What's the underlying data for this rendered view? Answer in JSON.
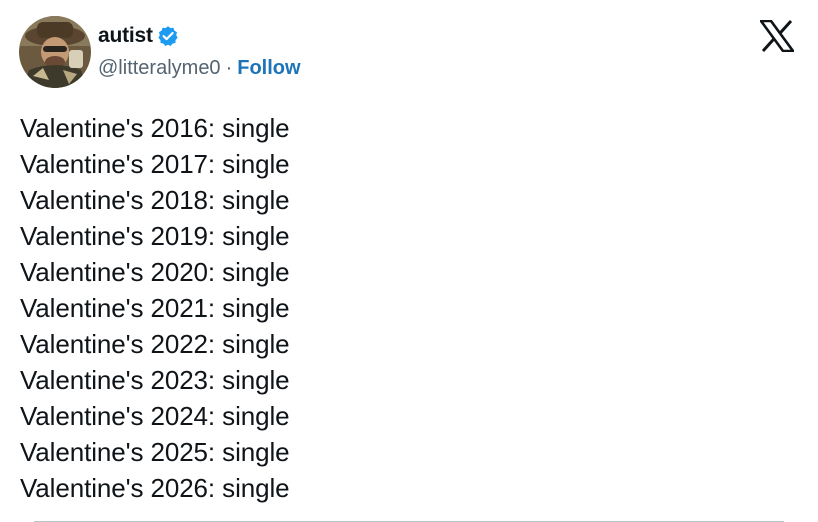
{
  "author": {
    "display_name": "autist",
    "verified": true,
    "handle": "@litteralyme0",
    "separator": "·",
    "follow_label": "Follow"
  },
  "brand": {
    "logo_icon": "x-logo-icon"
  },
  "tweet": {
    "lines": [
      "Valentine's 2016: single",
      "Valentine's 2017: single",
      "Valentine's 2018: single",
      "Valentine's 2019: single",
      "Valentine's 2020: single",
      "Valentine's 2021: single",
      "Valentine's 2022: single",
      "Valentine's 2023: single",
      "Valentine's 2024: single",
      "Valentine's 2025: single",
      "Valentine's 2026: single"
    ]
  },
  "colors": {
    "text": "#0f1419",
    "secondary": "#536471",
    "link": "#1d75b8",
    "verified_badge": "#1d9bf0"
  }
}
